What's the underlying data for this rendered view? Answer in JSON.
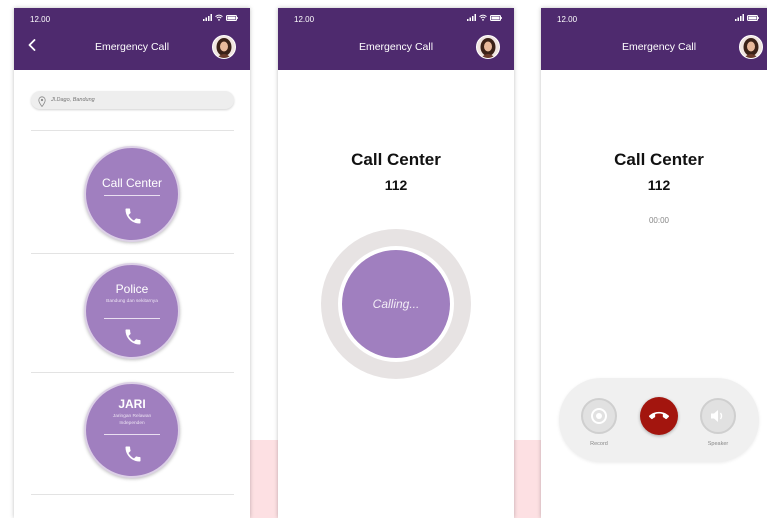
{
  "colors": {
    "header": "#4e2a6e",
    "accent": "#a07fbf",
    "end_call": "#a3150e",
    "background_accent": "#fde0e3"
  },
  "screen1": {
    "status_time": "12.00",
    "title": "Emergency Call",
    "search": {
      "placeholder": "Jl.Dago, Bandung",
      "icon": "location-pin-icon"
    },
    "services": [
      {
        "name": "Call Center",
        "description": "",
        "icon": "phone-icon"
      },
      {
        "name": "Police",
        "description": "Bandung dan sekitarnya",
        "icon": "phone-icon"
      },
      {
        "name": "JARI",
        "description": "Jaringan Relawan Independen",
        "icon": "phone-icon"
      }
    ]
  },
  "screen2": {
    "status_time": "12.00",
    "title": "Emergency Call",
    "call_name": "Call Center",
    "call_number": "112",
    "status": "Calling..."
  },
  "screen3": {
    "status_time": "12.00",
    "title": "Emergency Call",
    "call_name": "Call Center",
    "call_number": "112",
    "timer": "00:00",
    "controls": {
      "record_label": "Record",
      "speaker_label": "Speaker"
    }
  }
}
